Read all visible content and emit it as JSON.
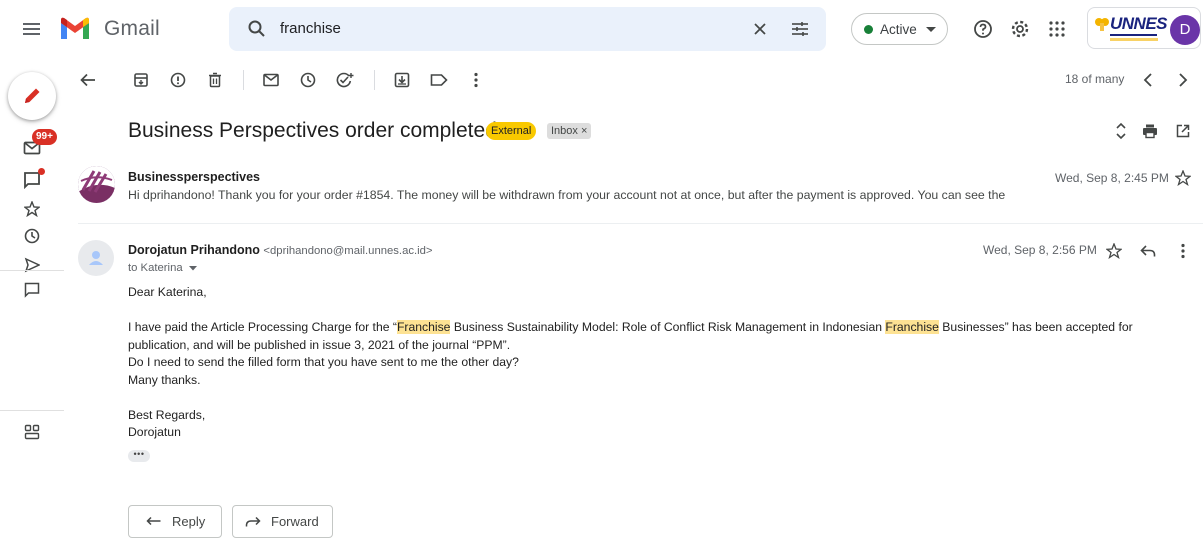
{
  "header": {
    "brand": "Gmail",
    "search_value": "franchise",
    "status": "Active",
    "org_logo_text": "UNNES",
    "avatar_initial": "D"
  },
  "left_rail": {
    "badge_count": "99+"
  },
  "toolbar": {
    "pager": "18 of many"
  },
  "thread": {
    "subject": "Business Perspectives order completed",
    "labels": [
      "External",
      "Inbox"
    ],
    "label_remove": "×"
  },
  "messages": [
    {
      "sender": "Businessperspectives",
      "snippet": "Hi dprihandono! Thank you for your order #1854. The money will be withdrawn from your account not at once, but after the payment is approved. You can see the or",
      "date": "Wed, Sep 8, 2:45 PM"
    },
    {
      "sender": "Dorojatun Prihandono",
      "email": "<dprihandono@mail.unnes.ac.id>",
      "to": "to Katerina",
      "date": "Wed, Sep 8, 2:56 PM",
      "body": {
        "greeting": "Dear Katerina,",
        "p1_a": "I have paid the Article Processing Charge for the  “",
        "p1_hl1": "Franchise",
        "p1_b": " Business Sustainability Model: Role of Conflict Risk Management in Indonesian ",
        "p1_hl2": "Franchise",
        "p1_c": " Businesses” has been accepted for publication, and will be published in issue 3, 2021 of the journal “PPM”.",
        "p2": "Do I need to send the filled form that you have sent to me the other day?",
        "p3": "Many thanks.",
        "sign1": "Best Regards,",
        "sign2": "Dorojatun"
      },
      "more": "•••"
    }
  ],
  "actions": {
    "reply": "Reply",
    "forward": "Forward"
  },
  "colors": {
    "external_label": "#f9c900",
    "highlight": "#fde293",
    "active_dot": "#188038",
    "badge": "#d93025"
  }
}
